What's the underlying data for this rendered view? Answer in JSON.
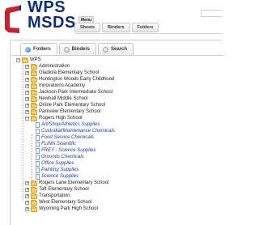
{
  "logo": {
    "line1": "WPS",
    "line2": "MSDS"
  },
  "header": {
    "menu_label": "Menu",
    "tabs": [
      "Sheets",
      "Binders",
      "Folders"
    ]
  },
  "panel": {
    "tabs": [
      {
        "label": "Folders",
        "active": true
      },
      {
        "label": "Binders",
        "active": false
      },
      {
        "label": "Search",
        "active": false
      }
    ]
  },
  "tree": {
    "root": "WPS",
    "folders_top": [
      "Administration",
      "Gladiola Elementary School",
      "Huntington Woods Early Childhood",
      "Innovations Academy",
      "Jackson Park Intermediate School",
      "Newhall Middle School",
      "Oriole Park Elementary School",
      "Parkview Elementary School",
      "Rogers High School"
    ],
    "rogers_items": [
      "Art/Shop/Athletics Supplies",
      "Custodial/Maintenance Chemicals",
      "Food Service Chemicals",
      "FLINN Scientific",
      "FREY - Science Supplies",
      "Grounds Chemicals",
      "Office Supplies",
      "Painting Supplies",
      "Science Supplies"
    ],
    "folders_bottom": [
      "Rogers Lane Elementary School",
      "Taft Elementary School",
      "Transportation",
      "West Elementary School",
      "Wyoming Park High School"
    ]
  },
  "colors": {
    "logo_blue": "#0d2f78",
    "logo_red": "#cc1f2e",
    "link_blue": "#1a3aa0"
  }
}
